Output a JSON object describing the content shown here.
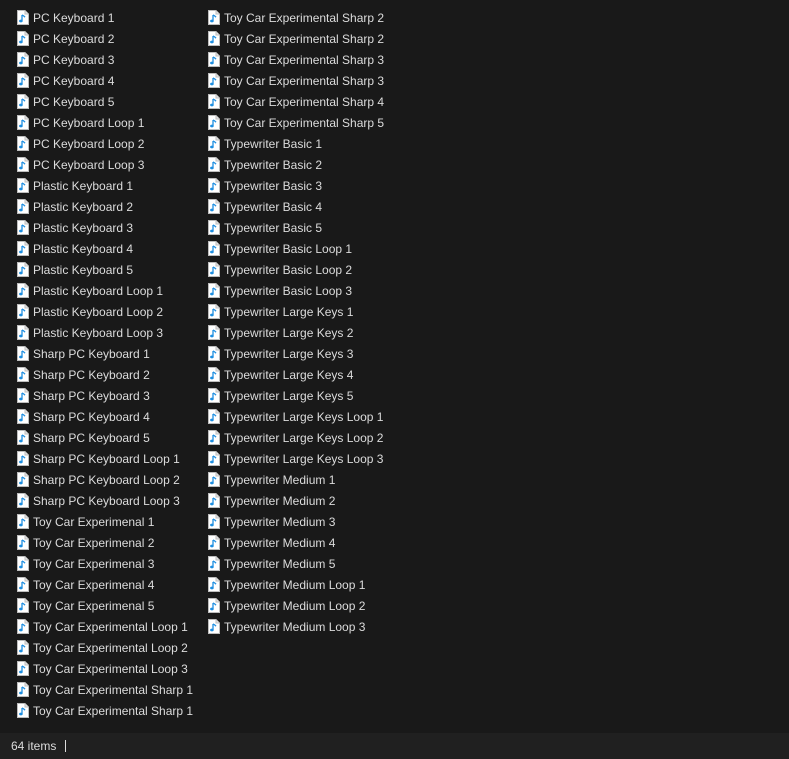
{
  "file_icon": "audio-file-icon",
  "colors": {
    "background": "#191919",
    "status_bar": "#202020",
    "text": "#dcdcdc",
    "icon_note": "#1e8ee0"
  },
  "columns": [
    {
      "items": [
        "PC Keyboard 1",
        "PC Keyboard 2",
        "PC Keyboard 3",
        "PC Keyboard 4",
        "PC Keyboard 5",
        "PC Keyboard Loop 1",
        "PC Keyboard Loop 2",
        "PC Keyboard Loop 3",
        "Plastic Keyboard 1",
        "Plastic Keyboard 2",
        "Plastic Keyboard 3",
        "Plastic Keyboard 4",
        "Plastic Keyboard 5",
        "Plastic Keyboard Loop 1",
        "Plastic Keyboard Loop 2",
        "Plastic Keyboard Loop 3",
        "Sharp PC Keyboard 1",
        "Sharp PC Keyboard 2",
        "Sharp PC Keyboard 3",
        "Sharp PC Keyboard 4",
        "Sharp PC Keyboard 5",
        "Sharp PC Keyboard Loop 1",
        "Sharp PC Keyboard Loop 2",
        "Sharp PC Keyboard Loop 3",
        "Toy Car Experimenal 1",
        "Toy Car Experimenal 2",
        "Toy Car Experimenal 3",
        "Toy Car Experimenal 4",
        "Toy Car Experimenal 5",
        "Toy Car Experimental Loop 1",
        "Toy Car Experimental Loop 2",
        "Toy Car Experimental Loop 3",
        "Toy Car Experimental Sharp 1",
        "Toy Car Experimental Sharp 1"
      ]
    },
    {
      "items": [
        "Toy Car Experimental Sharp 2",
        "Toy Car Experimental Sharp 2",
        "Toy Car Experimental Sharp 3",
        "Toy Car Experimental Sharp 3",
        "Toy Car Experimental Sharp 4",
        "Toy Car Experimental Sharp 5",
        "Typewriter Basic 1",
        "Typewriter Basic 2",
        "Typewriter Basic 3",
        "Typewriter Basic 4",
        "Typewriter Basic 5",
        "Typewriter Basic Loop 1",
        "Typewriter Basic Loop 2",
        "Typewriter Basic Loop 3",
        "Typewriter Large Keys 1",
        "Typewriter Large Keys 2",
        "Typewriter Large Keys 3",
        "Typewriter Large Keys 4",
        "Typewriter Large Keys 5",
        "Typewriter Large Keys Loop 1",
        "Typewriter Large Keys Loop 2",
        "Typewriter Large Keys Loop 3",
        "Typewriter Medium 1",
        "Typewriter Medium 2",
        "Typewriter Medium 3",
        "Typewriter Medium 4",
        "Typewriter Medium 5",
        "Typewriter Medium Loop 1",
        "Typewriter Medium Loop 2",
        "Typewriter Medium Loop 3"
      ]
    }
  ],
  "status_bar": {
    "item_count": "64 items"
  }
}
